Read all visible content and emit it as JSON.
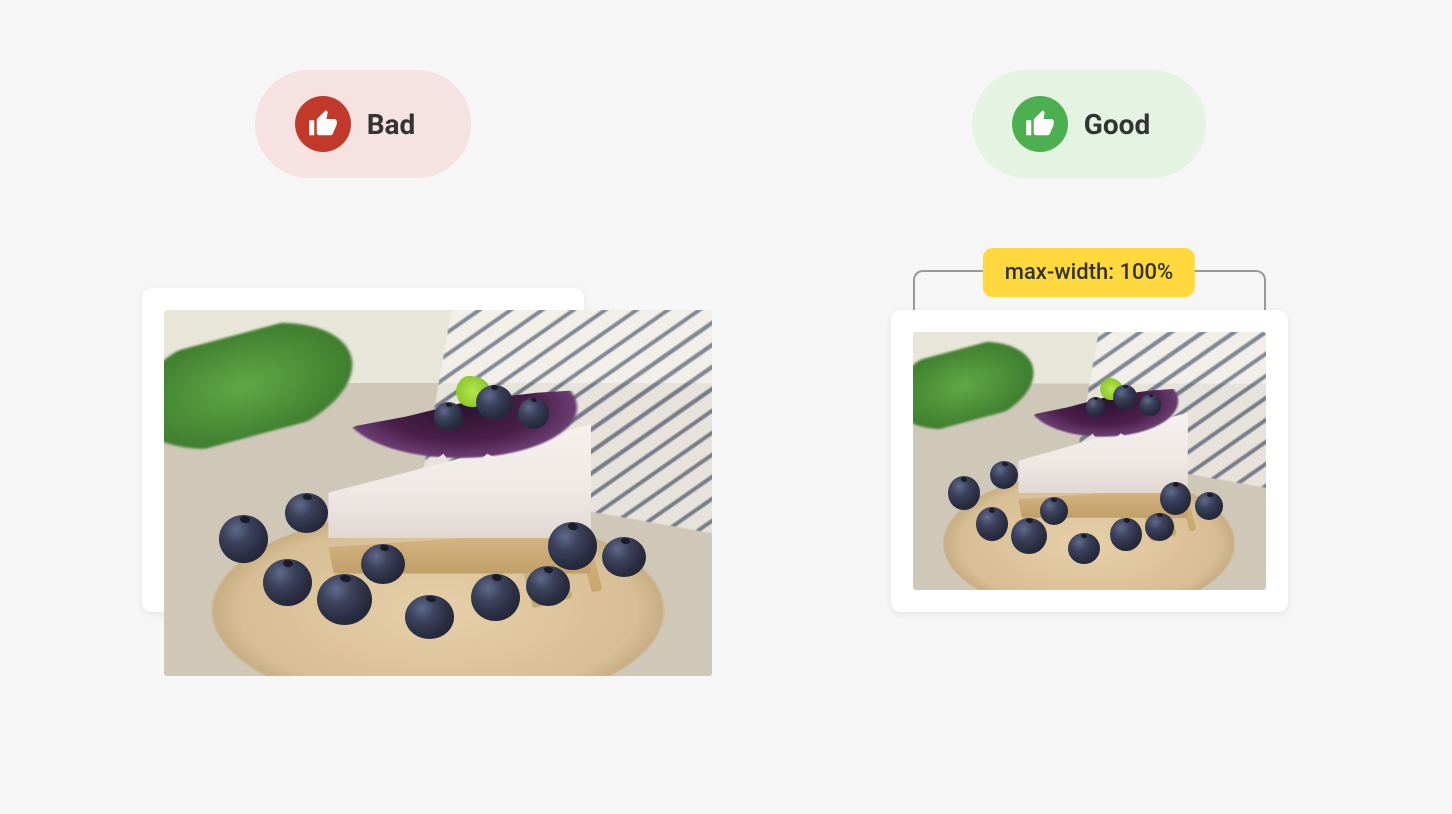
{
  "bad": {
    "label": "Bad"
  },
  "good": {
    "label": "Good",
    "annotation": "max-width: 100%"
  }
}
